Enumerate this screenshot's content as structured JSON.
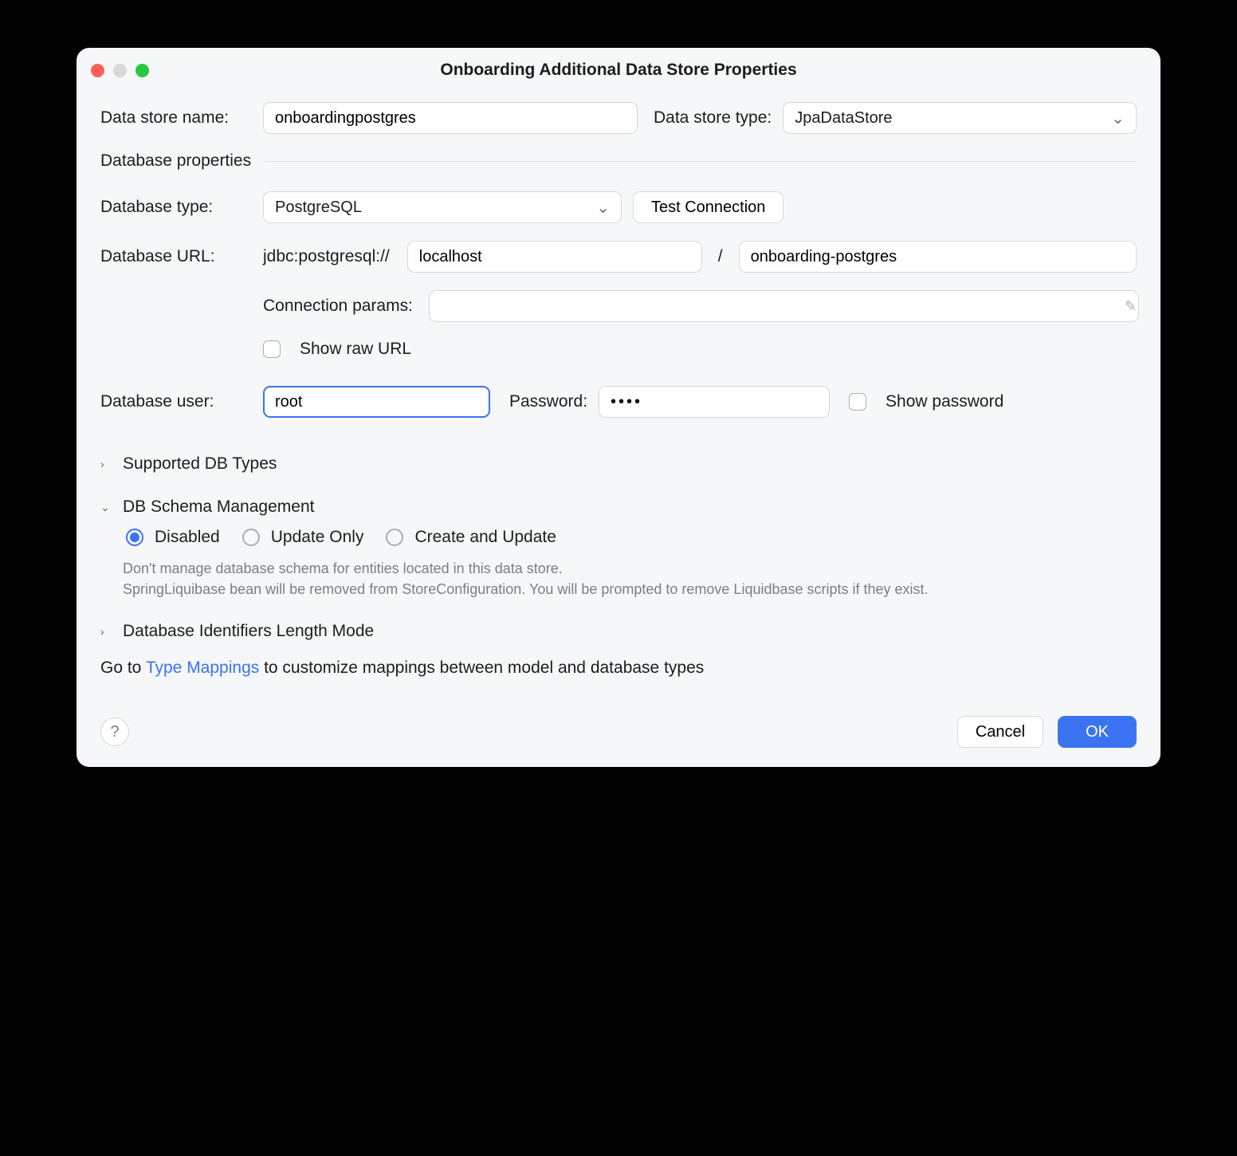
{
  "window": {
    "title": "Onboarding Additional Data Store Properties"
  },
  "form": {
    "data_store_name_label": "Data store name:",
    "data_store_name_value": "onboardingpostgres",
    "data_store_type_label": "Data store type:",
    "data_store_type_value": "JpaDataStore"
  },
  "db": {
    "section_title": "Database properties",
    "type_label": "Database type:",
    "type_value": "PostgreSQL",
    "test_button": "Test Connection",
    "url_label": "Database URL:",
    "url_prefix": "jdbc:postgresql://",
    "url_host": "localhost",
    "url_sep": "/",
    "url_dbname": "onboarding-postgres",
    "conn_params_label": "Connection params:",
    "conn_params_value": "",
    "show_raw_url_label": "Show raw URL",
    "user_label": "Database user:",
    "user_value": "root",
    "password_label": "Password:",
    "password_value": "••••",
    "show_password_label": "Show password"
  },
  "sections": {
    "supported_db_types": "Supported DB Types",
    "schema_mgmt": "DB Schema Management",
    "identifiers_mode": "Database Identifiers Length Mode"
  },
  "schema": {
    "options": {
      "disabled": "Disabled",
      "update_only": "Update Only",
      "create_update": "Create and Update"
    },
    "selected": "disabled",
    "help1": "Don't manage database schema for entities located in this data store.",
    "help2": "SpringLiquibase bean will be removed from StoreConfiguration. You will be prompted to remove Liquidbase scripts if they exist."
  },
  "footer": {
    "pre": "Go to ",
    "link": "Type Mappings",
    "post": " to customize mappings between model and database types"
  },
  "buttons": {
    "cancel": "Cancel",
    "ok": "OK"
  }
}
